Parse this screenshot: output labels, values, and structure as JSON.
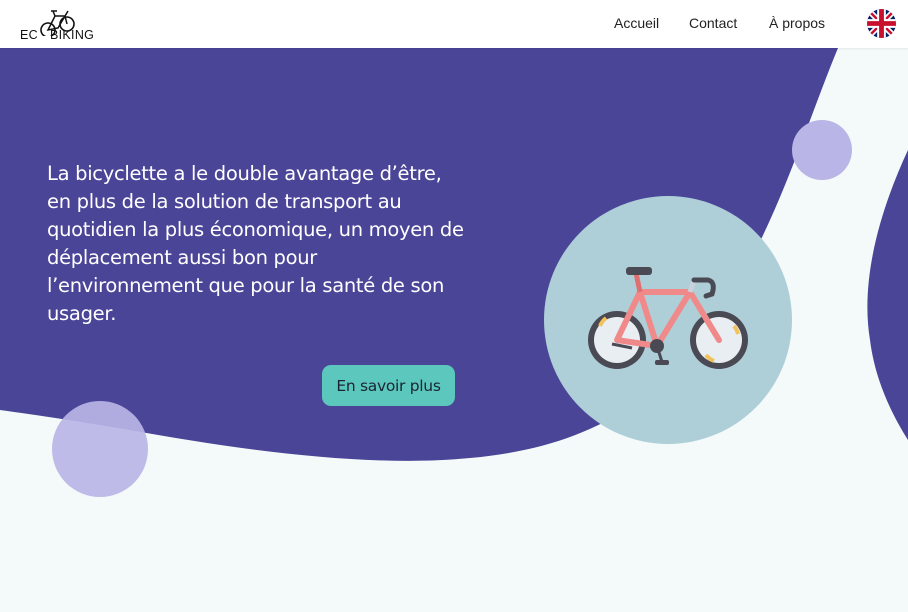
{
  "brand": {
    "logo_left": "EC",
    "logo_right": "BIKING"
  },
  "nav": {
    "items": [
      {
        "label": "Accueil"
      },
      {
        "label": "Contact"
      },
      {
        "label": "À propos"
      }
    ],
    "language_icon": "uk-flag-icon"
  },
  "hero": {
    "text": "La bicyclette a le double avantage d’être, en plus de la solution de transport au quotidien la plus économique, un moyen de déplacement aussi bon pour l’environnement que pour la santé de son usager.",
    "cta_label": "En savoir plus",
    "illustration_icon": "bicycle-icon"
  },
  "colors": {
    "purple": "#4b4598",
    "lavender": "#b9b5e6",
    "teal_circle": "#aecfd8",
    "cta": "#5cc7bd",
    "page_bg": "#f4fafa"
  }
}
